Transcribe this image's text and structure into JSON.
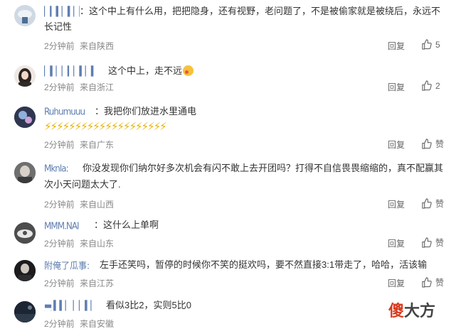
{
  "comments": [
    {
      "user": "▏▎▍▏▍▏▏▍",
      "avatar": "avatar-1",
      "text_line1": "：这个中上有什么用，把把隐身，还有视野，老问题了，不是被偷家就是被绕后，永远不",
      "text_line2": "长记性",
      "time": "2分钟前",
      "source": "来自陕西",
      "reply": "回复",
      "likes": "5"
    },
    {
      "user": "▏▍▏▏▎▏▍▏▍▏",
      "avatar": "avatar-2",
      "text_line1": "这个中上，走不远",
      "time": "2分钟前",
      "source": "来自浙江",
      "reply": "回复",
      "likes": "2"
    },
    {
      "user": "Ruhumuuu",
      "avatar": "avatar-3",
      "text_line1": "：我把你们放进水里通电",
      "text_line2": "⚡⚡⚡⚡⚡⚡⚡⚡⚡⚡⚡⚡⚡⚡⚡⚡⚡⚡⚡⚡",
      "time": "2分钟前",
      "source": "来自广东",
      "reply": "回复",
      "likes": "赞"
    },
    {
      "user": "Mknla:",
      "avatar": "avatar-4",
      "text_line1": "你没发现你们纳尔好多次机会有闪不敢上去开团吗？打得不自信畏畏缩缩的，真不配赢其",
      "text_line2": "次小天问题太大了.",
      "time": "2分钟前",
      "source": "来自山西",
      "reply": "回复",
      "likes": "赞"
    },
    {
      "user": "MMM.NAI",
      "avatar": "avatar-5",
      "text_line1": "：这什么上单啊",
      "time": "2分钟前",
      "source": "来自山东",
      "reply": "回复",
      "likes": "赞"
    },
    {
      "user": "附俺了瓜事:",
      "avatar": "avatar-6",
      "text_line1": "左手还笑吗，暂停的时候你不笑的挺欢吗，要不然直接3:1带走了，哈哈，活该输",
      "time": "2分钟前",
      "source": "来自江苏",
      "reply": "回复",
      "likes": "赞"
    },
    {
      "user": "▬ ▍▍▏ ▏▏▍▏ ▏▍:",
      "avatar": "avatar-7",
      "text_line1": "看似3比2，实则5比0",
      "time": "2分钟前",
      "source": "来自安徽",
      "reply": "",
      "likes": ""
    }
  ],
  "watermark": {
    "hi": "傻",
    "rest": "大方"
  },
  "colors": {
    "username": "#5f7eb0",
    "bolt": "#e8b400",
    "watermark": "#d93a1e"
  }
}
